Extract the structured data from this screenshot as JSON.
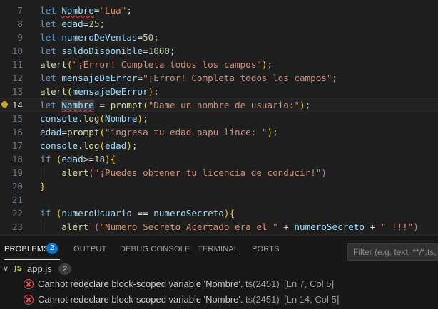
{
  "editor": {
    "lines": [
      {
        "n": "7",
        "tokens": [
          [
            "kw",
            "let "
          ],
          [
            "var squig",
            "Nombre"
          ],
          [
            "pl",
            "="
          ],
          [
            "str",
            "\"Lua\""
          ],
          [
            "pl",
            ";"
          ]
        ]
      },
      {
        "n": "8",
        "tokens": [
          [
            "kw",
            "let "
          ],
          [
            "var",
            "edad"
          ],
          [
            "pl",
            "="
          ],
          [
            "num",
            "25"
          ],
          [
            "pl",
            ";"
          ]
        ]
      },
      {
        "n": "9",
        "tokens": [
          [
            "kw",
            "let "
          ],
          [
            "var",
            "numeroDeVentas"
          ],
          [
            "pl",
            "="
          ],
          [
            "num",
            "50"
          ],
          [
            "pl",
            ";"
          ]
        ]
      },
      {
        "n": "10",
        "tokens": [
          [
            "kw",
            "let "
          ],
          [
            "var",
            "saldoDisponible"
          ],
          [
            "pl",
            "="
          ],
          [
            "num",
            "1000"
          ],
          [
            "pl",
            ";"
          ]
        ]
      },
      {
        "n": "11",
        "tokens": [
          [
            "fn",
            "alert"
          ],
          [
            "br1",
            "("
          ],
          [
            "str",
            "\"¡Error! Completa todos los campos\""
          ],
          [
            "br1",
            ")"
          ],
          [
            "pl",
            ";"
          ]
        ]
      },
      {
        "n": "12",
        "tokens": [
          [
            "kw",
            "let "
          ],
          [
            "var",
            "mensajeDeError"
          ],
          [
            "pl",
            "="
          ],
          [
            "str",
            "\"¡Error! Completa todos los campos\""
          ],
          [
            "pl",
            ";"
          ]
        ]
      },
      {
        "n": "13",
        "tokens": [
          [
            "fn",
            "alert"
          ],
          [
            "br1",
            "("
          ],
          [
            "var",
            "mensajeDeError"
          ],
          [
            "br1",
            ")"
          ],
          [
            "pl",
            ";"
          ]
        ]
      },
      {
        "n": "14",
        "tokens": [
          [
            "kw",
            "let "
          ],
          [
            "var squig hl",
            "Nombre"
          ],
          [
            "pl",
            " = "
          ],
          [
            "fn",
            "prompt"
          ],
          [
            "br1",
            "("
          ],
          [
            "str",
            "\"Dame un nombre de usuario:\""
          ],
          [
            "br1",
            ")"
          ],
          [
            "pl",
            ";"
          ]
        ]
      },
      {
        "n": "15",
        "tokens": [
          [
            "var",
            "console"
          ],
          [
            "pl",
            "."
          ],
          [
            "fn",
            "log"
          ],
          [
            "br1",
            "("
          ],
          [
            "var",
            "Nombre"
          ],
          [
            "br1",
            ")"
          ],
          [
            "pl",
            ";"
          ]
        ]
      },
      {
        "n": "16",
        "tokens": [
          [
            "var",
            "edad"
          ],
          [
            "pl",
            "="
          ],
          [
            "fn",
            "prompt"
          ],
          [
            "br1",
            "("
          ],
          [
            "str",
            "\"ingresa tu edad papu lince: \""
          ],
          [
            "br1",
            ")"
          ],
          [
            "pl",
            ";"
          ]
        ]
      },
      {
        "n": "17",
        "tokens": [
          [
            "var",
            "console"
          ],
          [
            "pl",
            "."
          ],
          [
            "fn",
            "log"
          ],
          [
            "br1",
            "("
          ],
          [
            "var",
            "edad"
          ],
          [
            "br1",
            ")"
          ],
          [
            "pl",
            ";"
          ]
        ]
      },
      {
        "n": "18",
        "tokens": [
          [
            "kw",
            "if "
          ],
          [
            "br1",
            "("
          ],
          [
            "var",
            "edad"
          ],
          [
            "pl",
            ">="
          ],
          [
            "num",
            "18"
          ],
          [
            "br1",
            ")"
          ],
          [
            "br1",
            "{"
          ]
        ]
      },
      {
        "n": "19",
        "tokens": [
          [
            "pl",
            "    "
          ],
          [
            "fn",
            "alert"
          ],
          [
            "br2",
            "("
          ],
          [
            "str",
            "\"¡Puedes obtener tu licencia de conducir!\""
          ],
          [
            "br2",
            ")"
          ]
        ]
      },
      {
        "n": "20",
        "tokens": [
          [
            "br1",
            "}"
          ]
        ]
      },
      {
        "n": "21",
        "tokens": []
      },
      {
        "n": "22",
        "tokens": [
          [
            "kw",
            "if "
          ],
          [
            "br1",
            "("
          ],
          [
            "var",
            "numeroUsuario"
          ],
          [
            "pl",
            " == "
          ],
          [
            "var",
            "numeroSecreto"
          ],
          [
            "br1",
            ")"
          ],
          [
            "br1",
            "{"
          ]
        ]
      },
      {
        "n": "23",
        "tokens": [
          [
            "pl",
            "    "
          ],
          [
            "fn",
            "alert "
          ],
          [
            "br2",
            "("
          ],
          [
            "str",
            "\"Numero Secreto Acertado era el \""
          ],
          [
            "pl",
            " + "
          ],
          [
            "var",
            "numeroSecreto"
          ],
          [
            "pl",
            " + "
          ],
          [
            "str",
            "\" !!!\""
          ],
          [
            "br2",
            ")"
          ]
        ]
      }
    ]
  },
  "panel": {
    "tabs": {
      "problems": "PROBLEMS",
      "problems_count": "2",
      "output": "OUTPUT",
      "debug_console": "DEBUG CONSOLE",
      "terminal": "TERMINAL",
      "ports": "PORTS"
    },
    "filter_placeholder": "Filter (e.g. text, **/*.ts, !**/node_modules/**)",
    "file": {
      "icon": "JS",
      "name": "app.js",
      "count": "2"
    },
    "problems": [
      {
        "message": "Cannot redeclare block-scoped variable 'Nombre'.",
        "source": "ts(2451)",
        "location": "[Ln 7, Col 5]"
      },
      {
        "message": "Cannot redeclare block-scoped variable 'Nombre'.",
        "source": "ts(2451)",
        "location": "[Ln 14, Col 5]"
      }
    ]
  },
  "colors": {
    "error": "#f14c4c",
    "accent": "#0078d4",
    "editor_bg": "#1f1f1f",
    "panel_bg": "#181818"
  }
}
